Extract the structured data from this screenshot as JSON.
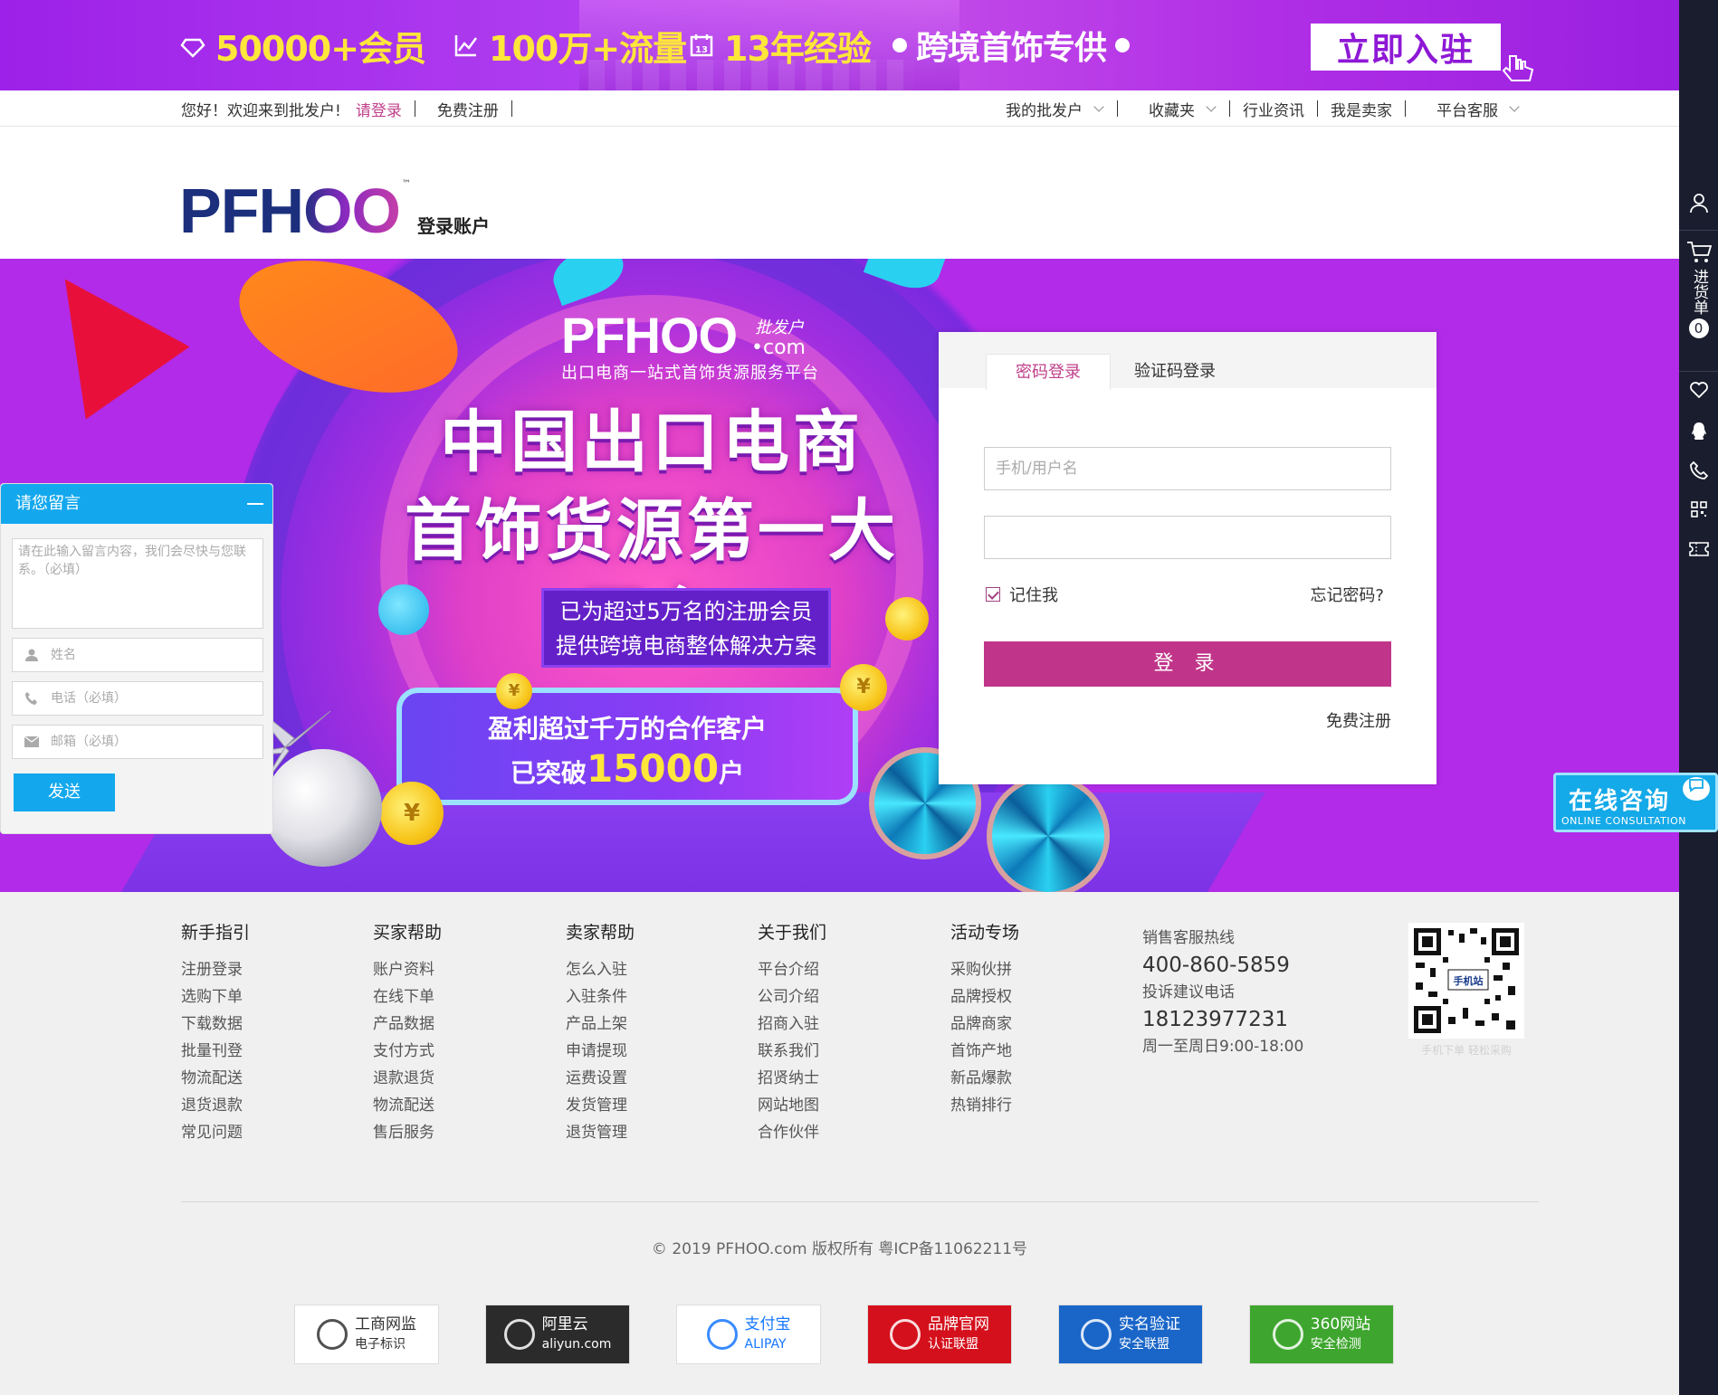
{
  "banner": {
    "members": "50000+会员",
    "traffic": "100万+流量",
    "experience": "13年经验",
    "slogan": "跨境首饰专供",
    "cta": "立即入驻",
    "calendar_num": "13"
  },
  "topnav": {
    "greeting": "您好！欢迎来到批发户!",
    "login": "请登录",
    "register": "免费注册",
    "my_store": "我的批发户",
    "favorites": "收藏夹",
    "news": "行业资讯",
    "seller": "我是卖家",
    "service": "平台客服"
  },
  "header": {
    "logo": "PFHOO",
    "logo_tm": "™",
    "subtitle": "登录账户"
  },
  "hero": {
    "brand": "PFHOO",
    "brand_cn": "批发户",
    "brand_com": "•com",
    "brand_slogan": "出口电商一站式首饰货源服务平台",
    "title_line1": "中国出口电商",
    "title_line2": "首饰货源第一大平台",
    "box_line1": "已为超过5万名的注册会员",
    "box_line2": "提供跨境电商整体解决方案",
    "bar_line1": "盈利超过千万的合作客户",
    "bar_line2_pre": "已突破",
    "bar_line2_num": "15000",
    "bar_line2_post": "户",
    "coin_symbol": "¥"
  },
  "login": {
    "tab_password": "密码登录",
    "tab_code": "验证码登录",
    "username_placeholder": "手机/用户名",
    "password_placeholder": "",
    "remember": "记住我",
    "forgot": "忘记密码?",
    "submit": "登 录",
    "register": "免费注册"
  },
  "message": {
    "title": "请您留言",
    "content_placeholder": "请在此输入留言内容，我们会尽快与您联系。（必填）",
    "name_placeholder": "姓名",
    "phone_placeholder": "电话（必填）",
    "email_placeholder": "邮箱（必填）",
    "send": "发送"
  },
  "sidebar": {
    "cart_label": "进货单",
    "cart_count": "0"
  },
  "consult": {
    "title": "在线咨询",
    "subtitle": "ONLINE CONSULTATION"
  },
  "footer": {
    "columns": [
      {
        "title": "新手指引",
        "items": [
          "注册登录",
          "选购下单",
          "下载数据",
          "批量刊登",
          "物流配送",
          "退货退款",
          "常见问题"
        ]
      },
      {
        "title": "买家帮助",
        "items": [
          "账户资料",
          "在线下单",
          "产品数据",
          "支付方式",
          "退款退货",
          "物流配送",
          "售后服务"
        ]
      },
      {
        "title": "卖家帮助",
        "items": [
          "怎么入驻",
          "入驻条件",
          "产品上架",
          "申请提现",
          "运费设置",
          "发货管理",
          "退货管理"
        ]
      },
      {
        "title": "关于我们",
        "items": [
          "平台介绍",
          "公司介绍",
          "招商入驻",
          "联系我们",
          "招贤纳士",
          "网站地图",
          "合作伙伴"
        ]
      },
      {
        "title": "活动专场",
        "items": [
          "采购伙拼",
          "品牌授权",
          "品牌商家",
          "首饰产地",
          "新品爆款",
          "热销排行"
        ]
      }
    ],
    "hotline_label": "销售客服热线",
    "hotline": "400-860-5859",
    "complaint_label": "投诉建议电话",
    "complaint": "18123977231",
    "hours": "周一至周日9:00-18:00",
    "qr_caption": "手机下单 轻松采购",
    "qr_label": "手机站",
    "copyright": "© 2019 PFHOO.com 版权所有 粤ICP备11062211号",
    "badges": [
      {
        "line1": "工商网监",
        "line2": "电子标识",
        "color": "#ffffff",
        "text_color": "#333333"
      },
      {
        "line1": "阿里云",
        "line2": "aliyun.com",
        "color": "#2b2b2b",
        "text_color": "#ffffff"
      },
      {
        "line1": "支付宝",
        "line2": "ALIPAY",
        "color": "#ffffff",
        "text_color": "#1677ff"
      },
      {
        "line1": "品牌官网",
        "line2": "认证联盟",
        "color": "#d4101c",
        "text_color": "#ffffff"
      },
      {
        "line1": "实名验证",
        "line2": "安全联盟",
        "color": "#1a66c8",
        "text_color": "#ffffff"
      },
      {
        "line1": "360网站",
        "line2": "安全检测",
        "color": "#3ea62e",
        "text_color": "#ffffff"
      }
    ]
  },
  "colors": {
    "accent": "#c0358a",
    "banner": "#a22be8",
    "hero": "#b12be8",
    "message_blue": "#13a8ee",
    "sidebar": "#1a1d2e"
  }
}
